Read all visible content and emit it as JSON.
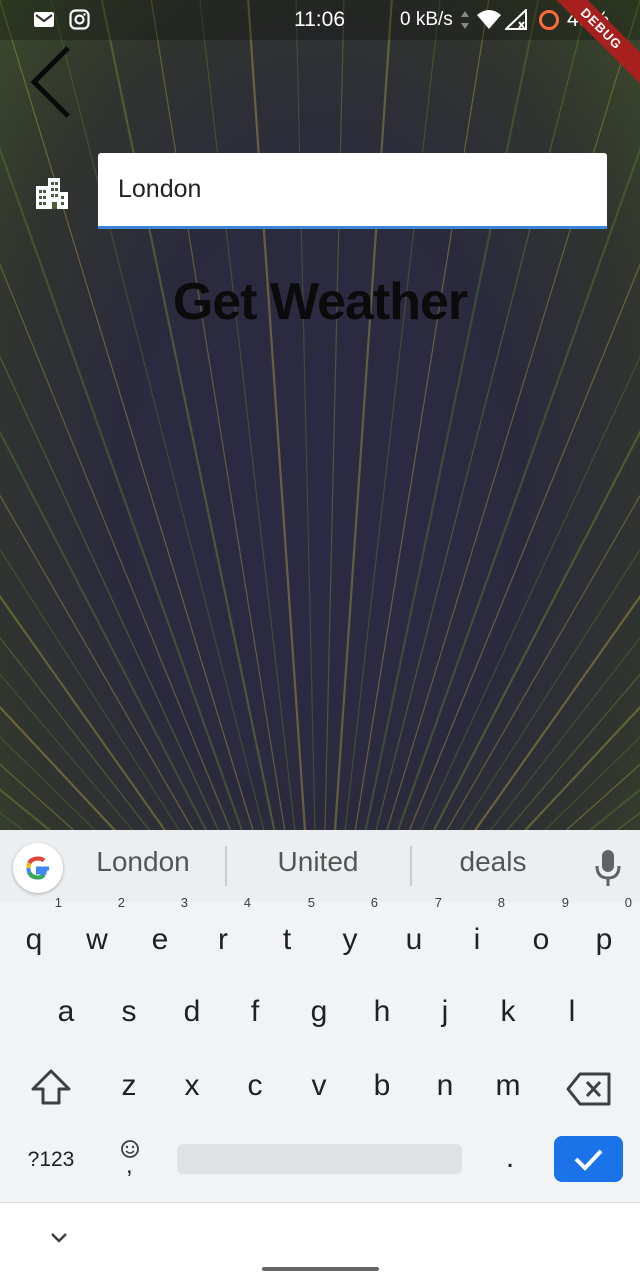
{
  "status_bar": {
    "time": "11:06",
    "network_speed": "0 kB/s",
    "battery": "49%",
    "debug_banner": "DEBUG"
  },
  "header": {
    "back_icon": "chevron-left-icon"
  },
  "city_field": {
    "icon": "city-buildings-icon",
    "value": "London"
  },
  "get_weather_label": "Get Weather",
  "keyboard": {
    "suggestions": [
      "London",
      "United",
      "deals"
    ],
    "row1": [
      {
        "key": "q",
        "hint": "1"
      },
      {
        "key": "w",
        "hint": "2"
      },
      {
        "key": "e",
        "hint": "3"
      },
      {
        "key": "r",
        "hint": "4"
      },
      {
        "key": "t",
        "hint": "5"
      },
      {
        "key": "y",
        "hint": "6"
      },
      {
        "key": "u",
        "hint": "7"
      },
      {
        "key": "i",
        "hint": "8"
      },
      {
        "key": "o",
        "hint": "9"
      },
      {
        "key": "p",
        "hint": "0"
      }
    ],
    "row2": [
      "a",
      "s",
      "d",
      "f",
      "g",
      "h",
      "j",
      "k",
      "l"
    ],
    "row3": [
      "z",
      "x",
      "c",
      "v",
      "b",
      "n",
      "m"
    ],
    "symbols_key": "?123",
    "comma_key": ",",
    "period_key": ".",
    "accent_color": "#1a73e8"
  }
}
